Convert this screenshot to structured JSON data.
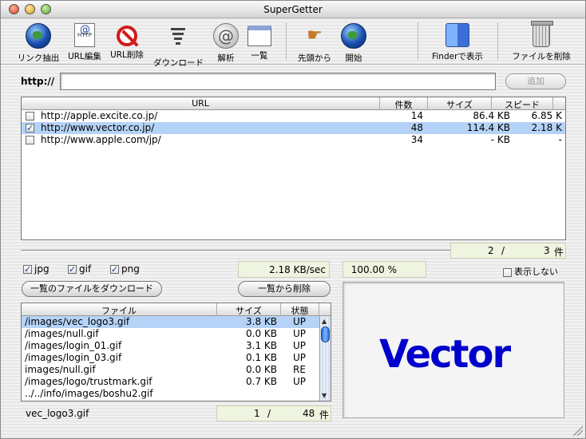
{
  "window": {
    "title": "SuperGetter"
  },
  "toolbar": {
    "items": [
      {
        "label": "リンク抽出",
        "icon": "globe-icon"
      },
      {
        "label": "URL編集",
        "icon": "http-document-icon"
      },
      {
        "label": "URL削除",
        "icon": "no-entry-icon"
      },
      {
        "label": "ダウンロード",
        "icon": "funnel-icon"
      },
      {
        "label": "解析",
        "icon": "analyze-icon"
      },
      {
        "label": "一覧",
        "icon": "list-window-icon"
      },
      {
        "label": "先頭から",
        "icon": "pointing-hand-icon"
      },
      {
        "label": "開始",
        "icon": "globe-icon"
      },
      {
        "label": "Finderで表示",
        "icon": "finder-icon"
      },
      {
        "label": "ファイルを削除",
        "icon": "trash-icon"
      }
    ]
  },
  "url_entry": {
    "label": "http://",
    "value": "",
    "add_button": "追加"
  },
  "url_table": {
    "columns": [
      "URL",
      "件数",
      "サイズ",
      "スピード"
    ],
    "rows": [
      {
        "checked": false,
        "url": "http://apple.excite.co.jp/",
        "count": "14",
        "size": "86.4 KB",
        "speed": "6.85 K",
        "selected": false
      },
      {
        "checked": true,
        "url": "http://www.vector.co.jp/",
        "count": "48",
        "size": "114.4 KB",
        "speed": "2.18 K",
        "selected": true
      },
      {
        "checked": false,
        "url": "http://www.apple.com/jp/",
        "count": "34",
        "size": "- KB",
        "speed": "-",
        "selected": false
      }
    ],
    "counter": {
      "current": "2",
      "sep": "/",
      "total": "3",
      "unit": "件"
    }
  },
  "filters": {
    "jpg": {
      "label": "jpg",
      "checked": true
    },
    "gif": {
      "label": "gif",
      "checked": true
    },
    "png": {
      "label": "png",
      "checked": true
    }
  },
  "stats": {
    "speed": "2.18 KB/sec",
    "percent": "100.00 %"
  },
  "hide_checkbox": {
    "label": "表示しない",
    "checked": false
  },
  "buttons": {
    "download_list": "一覧のファイルをダウンロード",
    "remove_from_list": "一覧から削除"
  },
  "file_table": {
    "columns": [
      "ファイル",
      "サイズ",
      "状態"
    ],
    "rows": [
      {
        "name": "/images/vec_logo3.gif",
        "size": "3.8 KB",
        "state": "UP",
        "selected": true
      },
      {
        "name": "/images/null.gif",
        "size": "0.0 KB",
        "state": "UP",
        "selected": false
      },
      {
        "name": "/images/login_01.gif",
        "size": "3.1 KB",
        "state": "UP",
        "selected": false
      },
      {
        "name": "/images/login_03.gif",
        "size": "0.1 KB",
        "state": "UP",
        "selected": false
      },
      {
        "name": "images/null.gif",
        "size": "0.0 KB",
        "state": "RE",
        "selected": false
      },
      {
        "name": "/images/logo/trustmark.gif",
        "size": "0.7 KB",
        "state": "UP",
        "selected": false
      },
      {
        "name": "../../info/images/boshu2.gif",
        "size": "",
        "state": "",
        "selected": false
      }
    ],
    "counter": {
      "current": "1",
      "sep": "/",
      "total": "48",
      "unit": "件"
    }
  },
  "preview": {
    "logo_text": "Vector",
    "logo_color": "#0000cc"
  },
  "status": {
    "selected_file": "vec_logo3.gif"
  }
}
